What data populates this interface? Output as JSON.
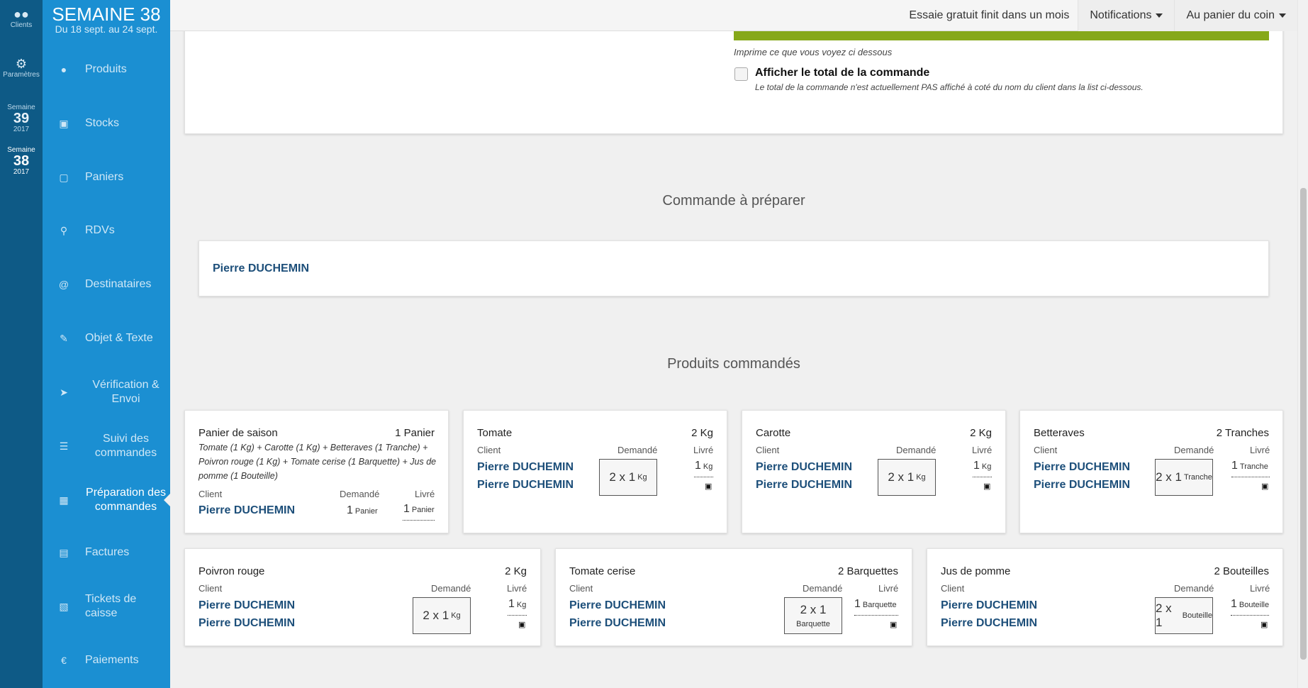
{
  "rail": {
    "items": [
      {
        "label": "Clients",
        "icon": "users-icon"
      },
      {
        "label": "Paramètres",
        "icon": "gear-icon"
      }
    ],
    "weeks": [
      {
        "label": "Semaine",
        "num": "39",
        "year": "2017"
      },
      {
        "label": "Semaine",
        "num": "38",
        "year": "2017"
      }
    ]
  },
  "sidebar": {
    "week_title": "SEMAINE 38",
    "week_range": "Du 18 sept. au 24 sept.",
    "items": [
      {
        "label": "Produits",
        "icon": "apple-icon"
      },
      {
        "label": "Stocks",
        "icon": "cubes-icon"
      },
      {
        "label": "Paniers",
        "icon": "basket-icon"
      },
      {
        "label": "RDVs",
        "icon": "map-marker-icon"
      },
      {
        "label": "Destinataires",
        "icon": "at-icon"
      },
      {
        "label": "Objet & Texte",
        "icon": "pencil-icon"
      },
      {
        "label": "Vérification & Envoi",
        "icon": "send-icon"
      },
      {
        "label": "Suivi des commandes",
        "icon": "list-icon"
      },
      {
        "label": "Préparation des commandes",
        "icon": "map-icon"
      },
      {
        "label": "Factures",
        "icon": "file-icon"
      },
      {
        "label": "Tickets de caisse",
        "icon": "receipt-icon"
      },
      {
        "label": "Paiements",
        "icon": "euro-icon"
      }
    ]
  },
  "topbar": {
    "trial": "Essaie gratuit finit dans un mois",
    "notifications": "Notifications",
    "account": "Au panier du coin"
  },
  "options": {
    "print_note": "Imprime ce que vous voyez ci dessous",
    "show_total_label": "Afficher le total de la commande",
    "show_total_desc": "Le total de la commande n'est actuellement PAS affiché à coté du nom du client dans la list ci-dessous."
  },
  "order": {
    "title": "Commande à préparer",
    "client": "Pierre DUCHEMIN"
  },
  "products": {
    "title": "Produits commandés",
    "headers": {
      "client": "Client",
      "asked": "Demandé",
      "delivered": "Livré"
    },
    "basket": {
      "name": "Panier de saison",
      "qty": "1 Panier",
      "desc": "Tomate (1 Kg) + Carotte (1 Kg) + Betteraves (1 Tranche) + Poivron rouge (1 Kg) + Tomate cerise (1 Barquette) + Jus de pomme (1 Bouteille)",
      "client": "Pierre DUCHEMIN",
      "asked_n": "1",
      "asked_u": "Panier",
      "deliv_n": "1",
      "deliv_u": "Panier"
    },
    "cards": [
      {
        "name": "Tomate",
        "qty": "2 Kg",
        "c1": "Pierre DUCHEMIN",
        "c2": "Pierre DUCHEMIN",
        "asked": "2 x 1",
        "unit": "Kg",
        "deliv_n": "1",
        "deliv_u": "Kg"
      },
      {
        "name": "Carotte",
        "qty": "2 Kg",
        "c1": "Pierre DUCHEMIN",
        "c2": "Pierre DUCHEMIN",
        "asked": "2 x 1",
        "unit": "Kg",
        "deliv_n": "1",
        "deliv_u": "Kg"
      },
      {
        "name": "Betteraves",
        "qty": "2 Tranches",
        "c1": "Pierre DUCHEMIN",
        "c2": "Pierre DUCHEMIN",
        "asked": "2 x 1",
        "unit": "Tranche",
        "deliv_n": "1",
        "deliv_u": "Tranche"
      },
      {
        "name": "Poivron rouge",
        "qty": "2 Kg",
        "c1": "Pierre DUCHEMIN",
        "c2": "Pierre DUCHEMIN",
        "asked": "2 x 1",
        "unit": "Kg",
        "deliv_n": "1",
        "deliv_u": "Kg"
      },
      {
        "name": "Tomate cerise",
        "qty": "2 Barquettes",
        "c1": "Pierre DUCHEMIN",
        "c2": "Pierre DUCHEMIN",
        "asked": "2 x 1",
        "unit": "Barquette",
        "deliv_n": "1",
        "deliv_u": "Barquette"
      },
      {
        "name": "Jus de pomme",
        "qty": "2 Bouteilles",
        "c1": "Pierre DUCHEMIN",
        "c2": "Pierre DUCHEMIN",
        "asked": "2 x 1",
        "unit": "Bouteille",
        "deliv_n": "1",
        "deliv_u": "Bouteille"
      }
    ]
  },
  "colors": {
    "rail": "#0e5a86",
    "sidebar": "#1b8fd2",
    "accent_green": "#86a81a",
    "client_blue": "#1d4f7a"
  }
}
